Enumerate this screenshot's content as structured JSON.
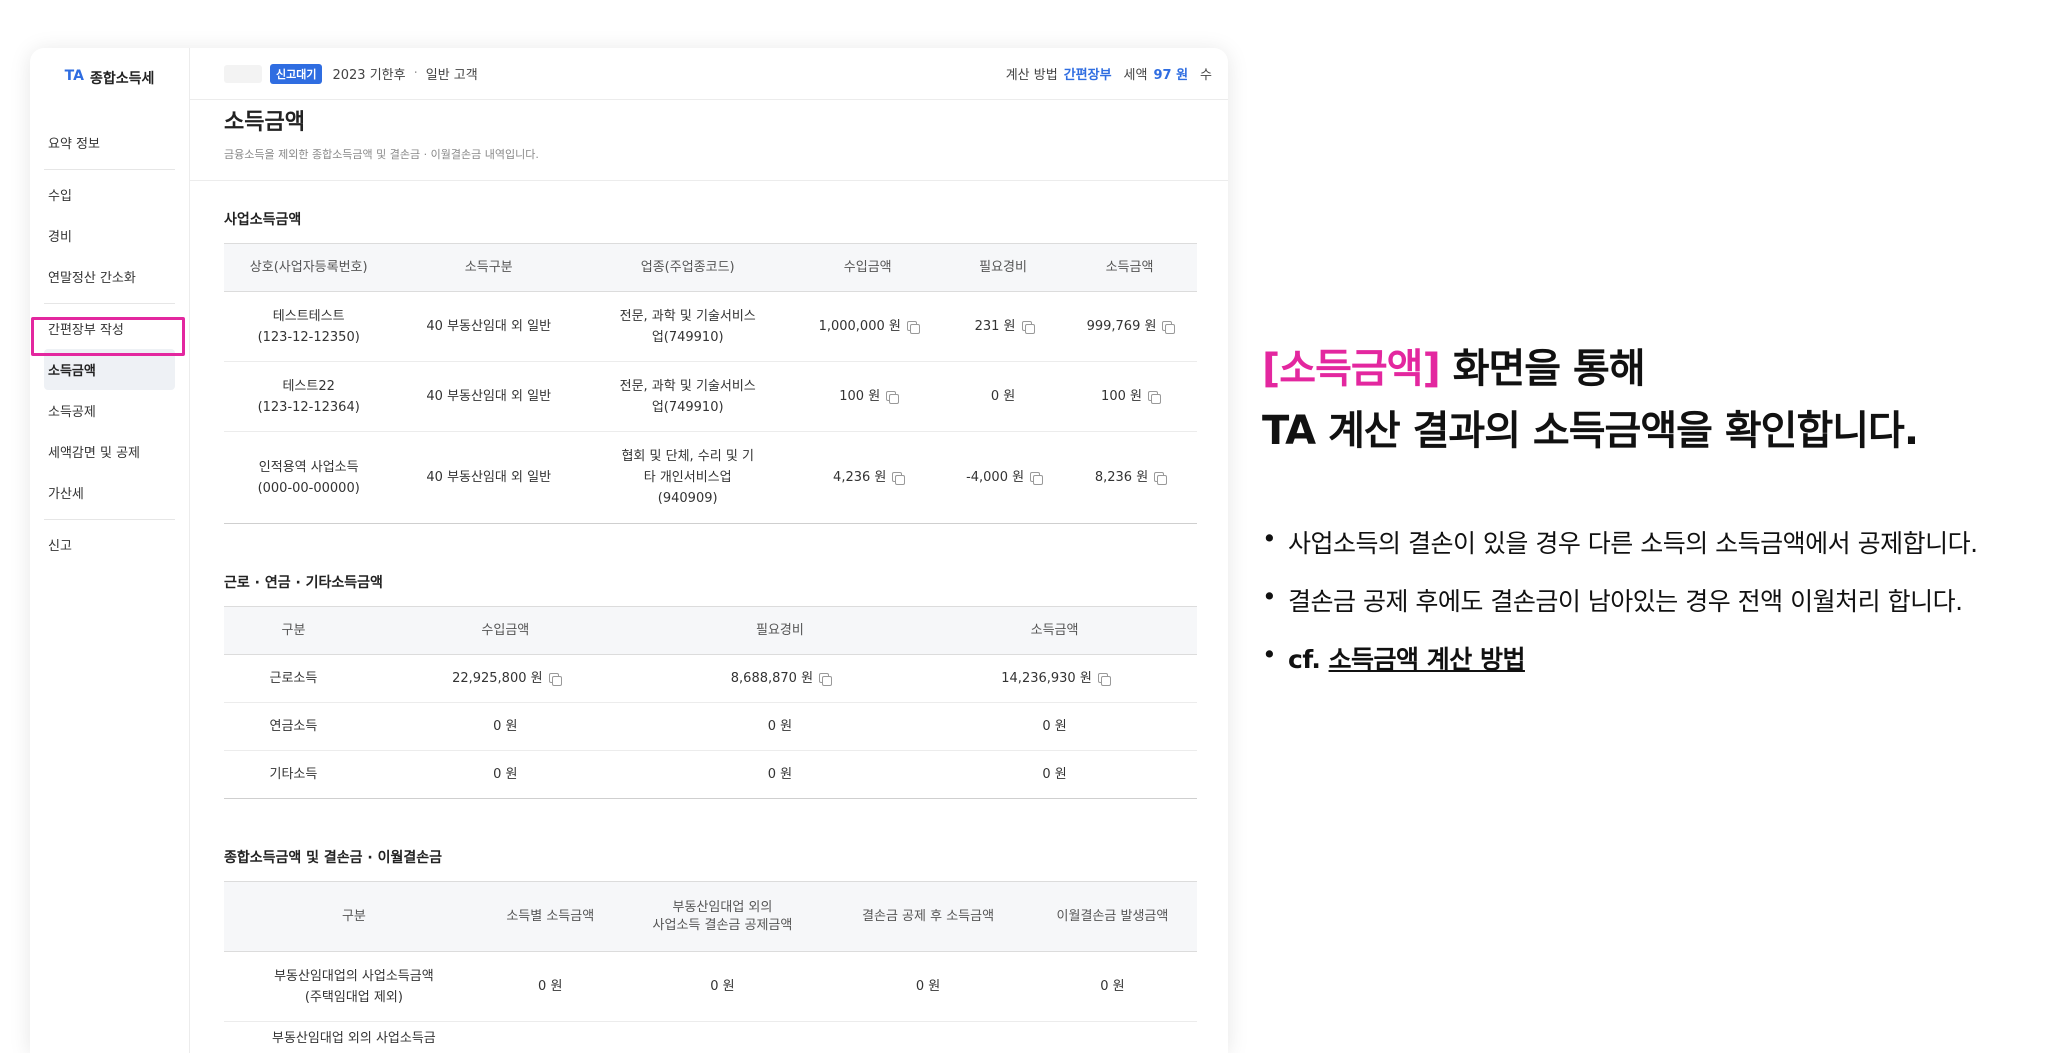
{
  "sidebar": {
    "brand_ta": "TA",
    "brand_name": "종합소득세",
    "groups": [
      [
        "요약 정보"
      ],
      [
        "수입",
        "경비",
        "연말정산 간소화"
      ],
      [
        "간편장부 작성",
        "소득금액",
        "소득공제",
        "세액감면 및 공제",
        "가산세"
      ],
      [
        "신고"
      ]
    ],
    "active": "소득금액"
  },
  "topbar": {
    "badge": "신고대기",
    "year": "2023 기한후",
    "customer": "일반 고객",
    "calc_label": "계산 방법",
    "calc_value": "간편장부",
    "tax_label": "세액",
    "tax_value": "97 원",
    "trunc": "수"
  },
  "page": {
    "title": "소득금액",
    "desc": "금융소득을 제외한 종합소득금액 및 결손금 · 이월결손금 내역입니다."
  },
  "business": {
    "title": "사업소득금액",
    "headers": [
      "상호(사업자등록번호)",
      "소득구분",
      "업종(주업종코드)",
      "수입금액",
      "필요경비",
      "소득금액"
    ],
    "rows": [
      {
        "name": "테스트테스트",
        "reg": "(123-12-12350)",
        "type": "40 부동산임대 외 일반",
        "industry1": "전문, 과학 및 기술서비스",
        "industry2": "업(749910)",
        "industry3": "",
        "revenue": "1,000,000 원",
        "expense": "231 원",
        "income": "999,769 원"
      },
      {
        "name": "테스트22",
        "reg": "(123-12-12364)",
        "type": "40 부동산임대 외 일반",
        "industry1": "전문, 과학 및 기술서비스",
        "industry2": "업(749910)",
        "industry3": "",
        "revenue": "100 원",
        "expense": "0 원",
        "income": "100 원"
      },
      {
        "name": "인적용역 사업소득",
        "reg": "(000-00-00000)",
        "type": "40 부동산임대 외 일반",
        "industry1": "협회 및 단체, 수리 및 기",
        "industry2": "타 개인서비스업",
        "industry3": "(940909)",
        "revenue": "4,236 원",
        "expense": "-4,000 원",
        "income": "8,236 원"
      }
    ]
  },
  "other": {
    "title": "근로 · 연금 · 기타소득금액",
    "headers": [
      "구분",
      "수입금액",
      "필요경비",
      "소득금액"
    ],
    "rows": [
      {
        "label": "근로소득",
        "revenue": "22,925,800 원",
        "expense": "8,688,870 원",
        "income": "14,236,930 원"
      },
      {
        "label": "연금소득",
        "revenue": "0 원",
        "expense": "0 원",
        "income": "0 원"
      },
      {
        "label": "기타소득",
        "revenue": "0 원",
        "expense": "0 원",
        "income": "0 원"
      }
    ]
  },
  "total": {
    "title": "종합소득금액 및 결손금 · 이월결손금",
    "headers": [
      "구분",
      "소득별 소득금액",
      "부동산임대업 외의",
      "사업소득 결손금 공제금액",
      "결손금 공제 후 소득금액",
      "이월결손금 발생금액"
    ],
    "rows": [
      {
        "label1": "부동산임대업의 사업소득금액",
        "label2": "(주택임대업 제외)",
        "v1": "0 원",
        "v2": "0 원",
        "v3": "0 원",
        "v4": "0 원"
      },
      {
        "label1": "부동산임대업 외의 사업소득금",
        "label2": "",
        "v1": "",
        "v2": "",
        "v3": "",
        "v4": ""
      }
    ]
  },
  "panel": {
    "bracket_title": "[소득금액]",
    "line1_rest": " 화면을 통해",
    "line2": "TA 계산 결과의 소득금액을 확인합니다.",
    "bullet1": "사업소득의 결손이 있을 경우 다른 소득의 소득금액에서 공제합니다.",
    "bullet2": "결손금 공제 후에도 결손금이 남아있는 경우 전액 이월처리 합니다.",
    "bullet3_prefix": "cf. ",
    "bullet3_link": "소득금액 계산 방법"
  },
  "colors": {
    "accent": "#2f6de1",
    "highlight": "#e3279f"
  }
}
